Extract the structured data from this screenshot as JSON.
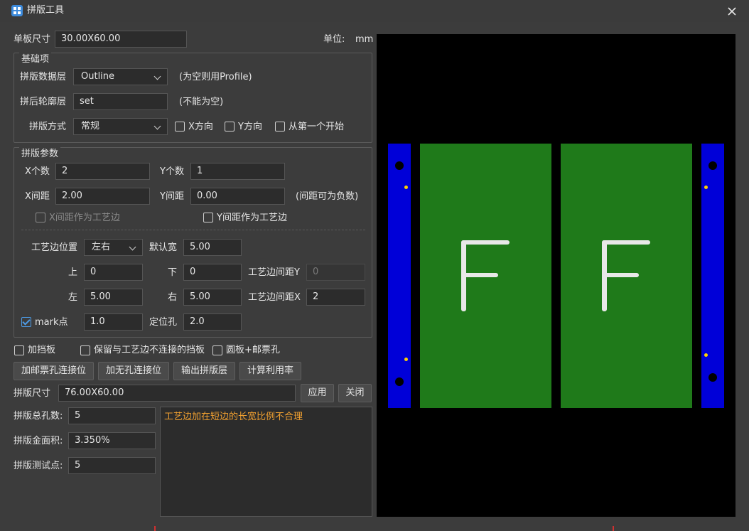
{
  "window": {
    "title": "拼版工具"
  },
  "header": {
    "board_size_label": "单板尺寸",
    "board_size_value": "30.00X60.00",
    "unit_label": "单位:",
    "unit_value": "mm"
  },
  "basic": {
    "title": "基础项",
    "data_layer_label": "拼版数据层",
    "data_layer_value": "Outline",
    "data_layer_hint": "(为空则用Profile)",
    "outline_layer_label": "拼后轮廓层",
    "outline_layer_value": "set",
    "outline_layer_hint": "(不能为空)",
    "mode_label": "拼版方式",
    "mode_value": "常规",
    "x_dir_label": "X方向",
    "y_dir_label": "Y方向",
    "from_first_label": "从第一个开始"
  },
  "params": {
    "title": "拼版参数",
    "x_count_label": "X个数",
    "x_count_value": "2",
    "y_count_label": "Y个数",
    "y_count_value": "1",
    "x_gap_label": "X间距",
    "x_gap_value": "2.00",
    "y_gap_label": "Y间距",
    "y_gap_value": "0.00",
    "gap_hint": "(间距可为负数)",
    "x_gap_edge_label": "X间距作为工艺边",
    "y_gap_edge_label": "Y间距作为工艺边",
    "edge_pos_label": "工艺边位置",
    "edge_pos_value": "左右",
    "default_width_label": "默认宽",
    "default_width_value": "5.00",
    "top_label": "上",
    "top_value": "0",
    "bottom_label": "下",
    "bottom_value": "0",
    "edge_gap_y_label": "工艺边间距Y",
    "edge_gap_y_value": "0",
    "left_label": "左",
    "left_value": "5.00",
    "right_label": "右",
    "right_value": "5.00",
    "edge_gap_x_label": "工艺边间距X",
    "edge_gap_x_value": "2",
    "mark_label": "mark点",
    "mark_value": "1.0",
    "locate_hole_label": "定位孔",
    "locate_hole_value": "2.0"
  },
  "options": {
    "baffle_label": "加挡板",
    "keep_baffle_label": "保留与工艺边不连接的挡板",
    "round_stamp_label": "圆板+邮票孔"
  },
  "actions": {
    "stamp_hole_label": "加邮票孔连接位",
    "no_hole_label": "加无孔连接位",
    "export_label": "输出拼版层",
    "calc_label": "计算利用率"
  },
  "panel": {
    "size_label": "拼版尺寸",
    "size_value": "76.00X60.00",
    "apply_label": "应用",
    "close_label": "关闭"
  },
  "stats": {
    "hole_count_label": "拼版总孔数:",
    "hole_count_value": "5",
    "gold_area_label": "拼版金面积:",
    "gold_area_value": "3.350%",
    "test_points_label": "拼版测试点:",
    "test_points_value": "5"
  },
  "message": {
    "text": "工艺边加在短边的长宽比例不合理",
    "color": "#f0a030"
  },
  "preview": {
    "board_label": "F",
    "colors": {
      "background": "#000000",
      "rail": "#0000d8",
      "board": "#1f7a1a",
      "mark": "#ffd200"
    }
  },
  "icons": {
    "app": "app-icon",
    "close": "close-icon"
  }
}
